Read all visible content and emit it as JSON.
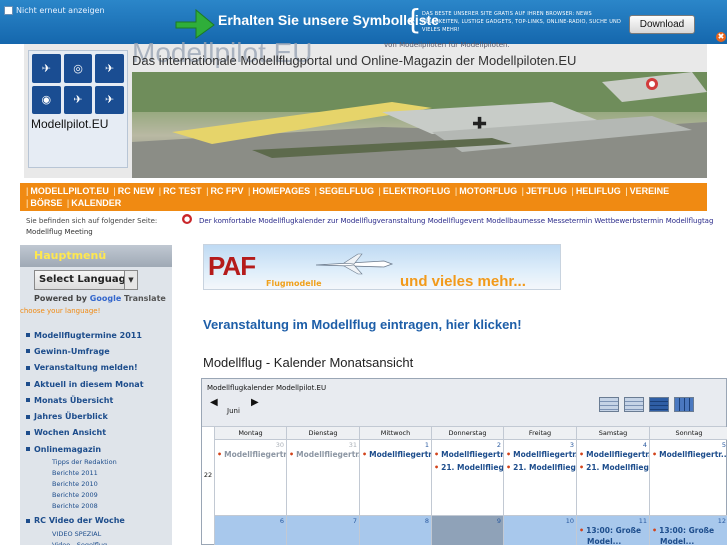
{
  "toolbar": {
    "checkbox_label": "Nicht erneut anzeigen",
    "title": "Erhalten Sie unsere Symbolleiste",
    "description": "DAS BESTE UNSERER SITE GRATIS AUF IHREN BROWSER: NEWS NEUIGKEITEN, LUSTIGE GADGETS, TOP-LINKS, ONLINE-RADIO, SUCHE UND VIELES MEHR!",
    "download_label": "Download",
    "close_symbol": "✖"
  },
  "header": {
    "logo_text": "Modellpilot.EU",
    "site_name": "Modellpilot.EU",
    "site_tagline": "von Modellpiloten für Modellpiloten.",
    "site_subtitle": "Das internationale Modellflugportal und Online-Magazin der Modellpiloten.EU",
    "logo_icons": [
      "✈",
      "◎",
      "✈",
      "◉",
      "✈",
      "✈"
    ]
  },
  "nav": {
    "items": [
      "MODELLPILOT.EU",
      "RC NEW",
      "RC TEST",
      "RC FPV",
      "HOMEPAGES",
      "SEGELFLUG",
      "ELEKTROFLUG",
      "MOTORFLUG",
      "JETFLUG",
      "HELIFLUG",
      "VEREINE",
      "BÖRSE",
      "KALENDER"
    ]
  },
  "breadcrumb": {
    "label": "Sie befinden sich auf folgender Seite:",
    "current": "Modellflug Meeting"
  },
  "ticker": {
    "text": "Der komfortable Modellflugkalender zur Modellflugveranstaltung Modellflugevent Modellbaumesse Messetermin Wettbewerbstermin Modellflugtag"
  },
  "sidebar": {
    "title": "Hauptmenü",
    "language_select": "Select Language",
    "powered_by": "Powered by",
    "google": "Google",
    "translate": "Translate",
    "choose_language": "choose your language!",
    "items": [
      {
        "label": "Modellflugtermine 2011",
        "type": "main"
      },
      {
        "label": "Gewinn-Umfrage",
        "type": "main"
      },
      {
        "label": "Veranstaltung melden!",
        "type": "main"
      },
      {
        "label": "Aktuell in diesem Monat",
        "type": "main"
      },
      {
        "label": "Monats Übersicht",
        "type": "main"
      },
      {
        "label": "Jahres Überblick",
        "type": "main"
      },
      {
        "label": "Wochen Ansicht",
        "type": "main"
      },
      {
        "label": "Onlinemagazin",
        "type": "main"
      },
      {
        "label": "Tipps der Redaktion",
        "type": "sub"
      },
      {
        "label": "Berichte 2011",
        "type": "sub"
      },
      {
        "label": "Berichte 2010",
        "type": "sub"
      },
      {
        "label": "Berichte 2009",
        "type": "sub"
      },
      {
        "label": "Berichte 2008",
        "type": "sub"
      },
      {
        "label": "RC Video der Woche",
        "type": "main"
      },
      {
        "label": "VIDEO SPEZIAL",
        "type": "sub"
      },
      {
        "label": "Video - Segelflug",
        "type": "sub"
      }
    ]
  },
  "ad": {
    "brand": "PAF",
    "brand_sub": "Flugmodelle",
    "slogan": "und vieles mehr..."
  },
  "main": {
    "cta": "Veranstaltung im Modellflug eintragen, hier klicken!",
    "calendar_heading": "Modellflug - Kalender Monatsansicht"
  },
  "calendar": {
    "title": "Modellflugkalender Modellpilot.EU",
    "month": "Juni",
    "prev_symbol": "◀",
    "next_symbol": "▶",
    "days_of_week": [
      "Montag",
      "Dienstag",
      "Mittwoch",
      "Donnerstag",
      "Freitag",
      "Samstag",
      "Sonntag"
    ],
    "weeks": [
      {
        "week_number": "22",
        "days": [
          {
            "num": "30",
            "other": true,
            "events": [
              "Modellfliegertr..."
            ]
          },
          {
            "num": "31",
            "other": true,
            "events": [
              "Modellfliegertr..."
            ]
          },
          {
            "num": "1",
            "other": false,
            "events": [
              "Modellfliegertr..."
            ]
          },
          {
            "num": "2",
            "other": false,
            "events": [
              "Modellfliegertr...",
              "21. Modellflieg..."
            ]
          },
          {
            "num": "3",
            "other": false,
            "events": [
              "Modellfliegertr...",
              "21. Modellflieg..."
            ]
          },
          {
            "num": "4",
            "other": false,
            "events": [
              "Modellfliegertr...",
              "21. Modellflieg..."
            ]
          },
          {
            "num": "5",
            "other": false,
            "events": [
              "Modellfliegertr..."
            ]
          }
        ]
      },
      {
        "week_number": "",
        "days": [
          {
            "num": "6",
            "other": false,
            "events": []
          },
          {
            "num": "7",
            "other": false,
            "events": []
          },
          {
            "num": "8",
            "other": false,
            "events": []
          },
          {
            "num": "9",
            "other": false,
            "events": []
          },
          {
            "num": "10",
            "other": false,
            "events": []
          },
          {
            "num": "11",
            "other": false,
            "events": [
              "13:00: Große",
              "Model..."
            ]
          },
          {
            "num": "12",
            "other": false,
            "events": [
              "13:00: Große",
              "Model..."
            ]
          }
        ]
      }
    ]
  },
  "colors": {
    "toolbar_blue": "#1a75bd",
    "nav_orange": "#f08a12",
    "link_blue": "#1d4d8c",
    "heading_blue": "#1d5ea8",
    "week2_highlight": "#a8c8ec",
    "today_highlight": "#8fa2b8"
  }
}
